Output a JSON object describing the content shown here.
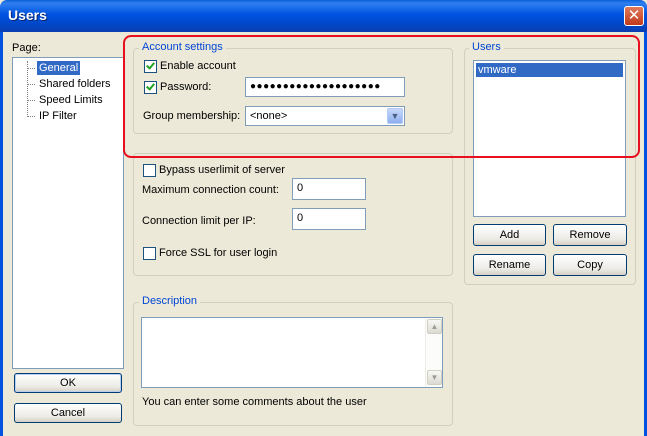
{
  "window": {
    "title": "Users",
    "close_glyph": "✕"
  },
  "page_panel": {
    "label": "Page:",
    "items": [
      "General",
      "Shared folders",
      "Speed Limits",
      "IP Filter"
    ],
    "selected": "General"
  },
  "account_settings": {
    "title": "Account settings",
    "enable_account_label": "Enable account",
    "enable_account_checked": true,
    "password_label": "Password:",
    "password_checked": true,
    "password_value": "●●●●●●●●●●●●●●●●●●●●",
    "group_label": "Group membership:",
    "group_value": "<none>"
  },
  "limits": {
    "bypass_label": "Bypass userlimit of server",
    "max_conn_label": "Maximum connection count:",
    "max_conn_value": "0",
    "conn_per_ip_label": "Connection limit per IP:",
    "conn_per_ip_value": "0",
    "force_ssl_label": "Force SSL for user login"
  },
  "description": {
    "title": "Description",
    "hint": "You can enter some comments about the user",
    "value": ""
  },
  "users": {
    "title": "Users",
    "list": [
      "vmware"
    ],
    "selected": "vmware",
    "add_label": "Add",
    "remove_label": "Remove",
    "rename_label": "Rename",
    "copy_label": "Copy"
  },
  "footer": {
    "ok_label": "OK",
    "cancel_label": "Cancel"
  },
  "icons": {
    "close": "close-icon",
    "dropdown": "chevron-down-icon",
    "scroll_up": "arrow-up-icon",
    "scroll_down": "arrow-down-icon"
  },
  "colors": {
    "title_bar": "#0053e1",
    "highlight": "#e8101e",
    "selection": "#316ac5",
    "group_title": "#0046d5"
  }
}
